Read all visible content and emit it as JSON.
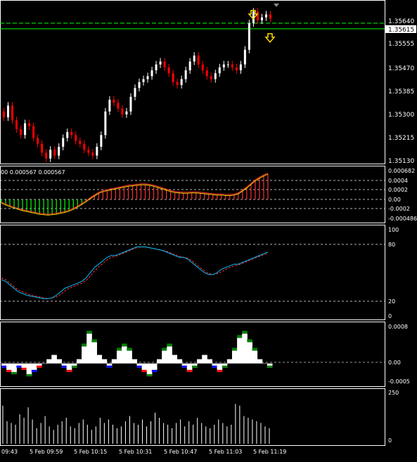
{
  "colors": {
    "background": "#000000",
    "bull_candle": "#ffffff",
    "bear_candle": "#ff0000",
    "ask_line": "#00ff00",
    "bid_line": "#00ff00",
    "grid": "#ffffff",
    "osma_pos": "#ff3030",
    "osma_neg": "#00ff00",
    "stoch_main": "#00c0ff",
    "stoch_signal": "#ff3030",
    "arrow": "#ffd700"
  },
  "main": {
    "price_labels": [
      "1.35640",
      "1.35615",
      "1.35555",
      "1.35470",
      "1.35385",
      "1.35300",
      "1.35215",
      "1.35130"
    ],
    "current_price": "1.35615",
    "arrow_icons": [
      "arrow-down-icon",
      "arrow-down-icon"
    ]
  },
  "macd_panel": {
    "header": "00 0.000567 0.000567",
    "scale_labels": [
      "0.000682",
      "0.0004",
      "0.0002",
      "0.00",
      "-0.0002",
      "-0.000486"
    ]
  },
  "stoch_panel": {
    "scale_labels": [
      "100",
      "80",
      "20",
      "0"
    ]
  },
  "osc_panel": {
    "scale_labels": [
      "0.0008",
      "0.00",
      "-0.0005"
    ]
  },
  "volume_panel": {
    "scale_labels": [
      "250",
      "0"
    ]
  },
  "time_axis": {
    "labels": [
      "09:43",
      "5 Feb 09:59",
      "5 Feb 10:15",
      "5 Feb 10:31",
      "5 Feb 10:47",
      "5 Feb 11:03",
      "5 Feb 11:19"
    ]
  },
  "chart_data": [
    {
      "type": "candlestick",
      "title": "",
      "ylim": [
        1.3513,
        1.3566
      ],
      "closes": [
        1.3528,
        1.3532,
        1.3527,
        1.3524,
        1.3522,
        1.3526,
        1.3525,
        1.3521,
        1.3519,
        1.3516,
        1.3514,
        1.3517,
        1.3515,
        1.3518,
        1.3521,
        1.3523,
        1.3522,
        1.352,
        1.3519,
        1.3517,
        1.3516,
        1.3515,
        1.3518,
        1.3522,
        1.353,
        1.3534,
        1.3533,
        1.3531,
        1.3529,
        1.353,
        1.3535,
        1.3538,
        1.354,
        1.3541,
        1.3542,
        1.3544,
        1.3546,
        1.3547,
        1.3545,
        1.3543,
        1.354,
        1.3539,
        1.3541,
        1.3544,
        1.3547,
        1.3549,
        1.3546,
        1.3544,
        1.3542,
        1.3541,
        1.3543,
        1.3545,
        1.3546,
        1.3546,
        1.3545,
        1.3544,
        1.3546,
        1.3551,
        1.356,
        1.3564,
        1.3561,
        1.3562,
        1.3563,
        1.35615
      ],
      "opens": [
        1.353,
        1.3528,
        1.3532,
        1.3527,
        1.3524,
        1.3522,
        1.3526,
        1.3525,
        1.3521,
        1.3519,
        1.3516,
        1.3514,
        1.3517,
        1.3515,
        1.3518,
        1.3521,
        1.3523,
        1.3522,
        1.352,
        1.3519,
        1.3517,
        1.3516,
        1.3515,
        1.3518,
        1.3522,
        1.353,
        1.3534,
        1.3533,
        1.3531,
        1.3529,
        1.353,
        1.3535,
        1.3538,
        1.354,
        1.3541,
        1.3542,
        1.3544,
        1.3546,
        1.3547,
        1.3545,
        1.3543,
        1.354,
        1.3539,
        1.3541,
        1.3544,
        1.3547,
        1.3549,
        1.3546,
        1.3544,
        1.3542,
        1.3541,
        1.3543,
        1.3545,
        1.3546,
        1.3546,
        1.3545,
        1.3544,
        1.3546,
        1.3551,
        1.356,
        1.3564,
        1.3561,
        1.3562,
        1.3563
      ]
    },
    {
      "type": "bar",
      "title": "",
      "ylim": [
        -0.000486,
        0.000682
      ],
      "values": [
        -8e-05,
        -0.00012,
        -0.00016,
        -0.00019,
        -0.00022,
        -0.00025,
        -0.00027,
        -0.00029,
        -0.00031,
        -0.00033,
        -0.00034,
        -0.00035,
        -0.00034,
        -0.00033,
        -0.00031,
        -0.00029,
        -0.00026,
        -0.00022,
        -0.00017,
        -0.00011,
        -5e-05,
        2e-05,
        8e-05,
        0.00014,
        0.00018,
        0.0002,
        0.00022,
        0.00024,
        0.00026,
        0.00028,
        0.0003,
        0.00031,
        0.00032,
        0.00033,
        0.00033,
        0.00032,
        0.0003,
        0.00027,
        0.00024,
        0.00021,
        0.00018,
        0.00016,
        0.00015,
        0.00014,
        0.00014,
        0.00015,
        0.00015,
        0.00014,
        0.00013,
        0.00012,
        0.00011,
        0.0001,
        0.0001,
        9e-05,
        9e-05,
        0.0001,
        0.00013,
        0.00019,
        0.00026,
        0.00034,
        0.00042,
        0.00048,
        0.00053,
        0.00057
      ]
    },
    {
      "type": "line",
      "title": "",
      "ylim": [
        0,
        100
      ],
      "series": [
        {
          "values": [
            42,
            40,
            36,
            32,
            28,
            26,
            24,
            23,
            22,
            21,
            20,
            20,
            21,
            24,
            28,
            32,
            34,
            36,
            38,
            40,
            44,
            50,
            56,
            60,
            64,
            68,
            70,
            70,
            72,
            74,
            76,
            78,
            80,
            80,
            80,
            79,
            78,
            77,
            76,
            74,
            72,
            70,
            68,
            68,
            66,
            62,
            58,
            54,
            50,
            48,
            48,
            50,
            54,
            56,
            58,
            60,
            60,
            62,
            64,
            66,
            68,
            70,
            72,
            74
          ]
        },
        {
          "values": [
            44,
            42,
            38,
            34,
            30,
            28,
            26,
            24,
            23,
            22,
            21,
            20,
            21,
            22,
            25,
            29,
            32,
            34,
            36,
            38,
            41,
            46,
            52,
            57,
            61,
            65,
            68,
            69,
            71,
            73,
            75,
            77,
            79,
            80,
            80,
            79,
            78,
            77,
            76,
            75,
            73,
            71,
            69,
            68,
            67,
            64,
            60,
            56,
            52,
            49,
            48,
            49,
            51,
            54,
            56,
            58,
            59,
            61,
            63,
            65,
            67,
            69,
            71,
            72
          ]
        }
      ]
    },
    {
      "type": "bar",
      "title": "",
      "ylim": [
        -0.0005,
        0.0009
      ],
      "values": [
        -0.0001,
        -0.0002,
        -0.00025,
        -0.0001,
        -0.00015,
        -0.0003,
        -0.0002,
        -0.0001,
        0,
        0.0001,
        0.0002,
        0.0001,
        -0.0001,
        -0.0002,
        -0.0001,
        0.0001,
        0.0004,
        0.0007,
        0.0005,
        0.0002,
        0.0001,
        -0.0001,
        0.0001,
        0.0003,
        0.0004,
        0.0003,
        0.0001,
        -0.0001,
        -0.0002,
        -0.0003,
        -0.0002,
        0.0001,
        0.0003,
        0.0004,
        0.0002,
        0.0001,
        -0.0001,
        -0.0002,
        -0.0001,
        0.0001,
        0.0002,
        0.0001,
        -0.0001,
        -0.0002,
        -0.0001,
        0.0001,
        0.0003,
        0.0006,
        0.0007,
        0.0005,
        0.0003,
        0.0001,
        0,
        -0.0001
      ]
    },
    {
      "type": "bar",
      "title": "",
      "ylim": [
        0,
        300
      ],
      "values": [
        220,
        130,
        120,
        110,
        170,
        150,
        210,
        140,
        90,
        120,
        160,
        100,
        80,
        110,
        130,
        150,
        100,
        90,
        120,
        140,
        110,
        80,
        100,
        150,
        120,
        140,
        110,
        90,
        100,
        130,
        160,
        120,
        110,
        140,
        100,
        130,
        180,
        150,
        120,
        110,
        90,
        120,
        140,
        100,
        130,
        110,
        150,
        120,
        100,
        90,
        110,
        140,
        120,
        100,
        110,
        230,
        220,
        160,
        150,
        140,
        130,
        120,
        100,
        90
      ]
    }
  ]
}
